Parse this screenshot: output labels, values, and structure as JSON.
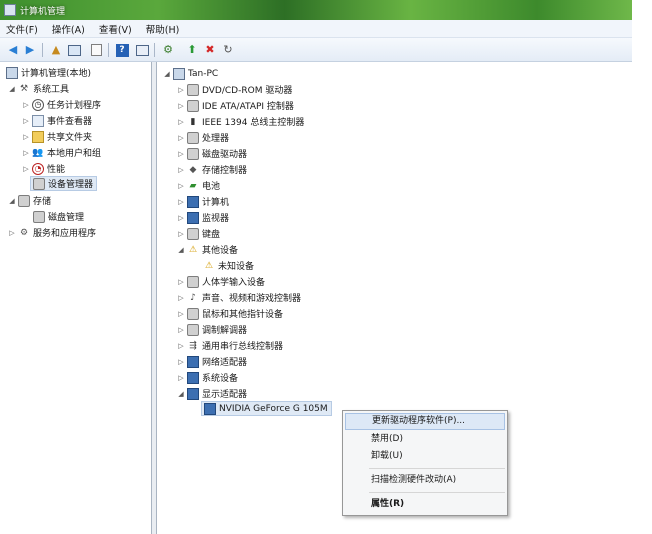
{
  "window": {
    "title": "计算机管理"
  },
  "menu": [
    "文件(F)",
    "操作(A)",
    "查看(V)",
    "帮助(H)"
  ],
  "left_tree": [
    {
      "label": "计算机管理(本地)"
    },
    {
      "label": "系统工具"
    },
    {
      "label": "任务计划程序"
    },
    {
      "label": "事件查看器"
    },
    {
      "label": "共享文件夹"
    },
    {
      "label": "本地用户和组"
    },
    {
      "label": "性能"
    },
    {
      "label": "设备管理器"
    },
    {
      "label": "存储"
    },
    {
      "label": "磁盘管理"
    },
    {
      "label": "服务和应用程序"
    }
  ],
  "device_tree": {
    "root": "Tan-PC",
    "items": [
      "DVD/CD-ROM 驱动器",
      "IDE ATA/ATAPI 控制器",
      "IEEE 1394 总线主控制器",
      "处理器",
      "磁盘驱动器",
      "存储控制器",
      "电池",
      "计算机",
      "监视器",
      "键盘",
      "其他设备",
      "未知设备",
      "人体学输入设备",
      "声音、视频和游戏控制器",
      "鼠标和其他指针设备",
      "调制解调器",
      "通用串行总线控制器",
      "网络适配器",
      "系统设备",
      "显示适配器",
      "NVIDIA GeForce G 105M"
    ]
  },
  "context_menu": {
    "update_driver": "更新驱动程序软件(P)...",
    "disable": "禁用(D)",
    "uninstall": "卸载(U)",
    "scan": "扫描检测硬件改动(A)",
    "properties": "属性(R)"
  }
}
